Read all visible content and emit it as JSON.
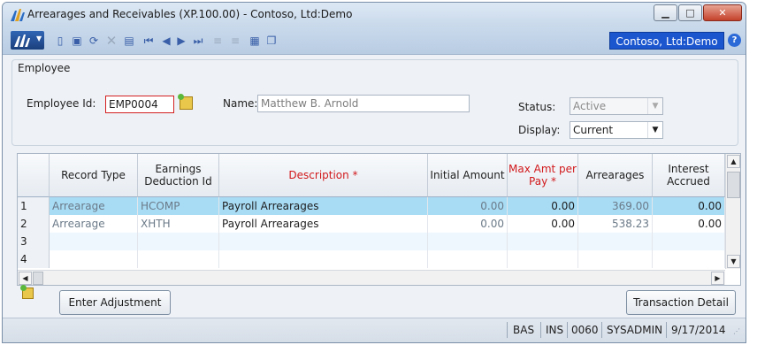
{
  "window": {
    "title": "Arrearages and Receivables (XP.100.00) - Contoso, Ltd:Demo",
    "minimize": "▁",
    "maximize": "□",
    "close": "✕"
  },
  "toolbar": {
    "company": "Contoso, Ltd:Demo",
    "help": "?",
    "icons": [
      "new-icon",
      "save-icon",
      "refresh-icon",
      "delete-icon",
      "close-record-icon",
      "first-icon",
      "previous-icon",
      "next-icon",
      "last-icon",
      "note-icon",
      "note-alt-icon",
      "report-icon",
      "copy-icon"
    ]
  },
  "employee": {
    "group_title": "Employee",
    "id_label": "Employee Id:",
    "id_value": "EMP0004",
    "name_label": "Name:",
    "name_value": "Matthew B. Arnold",
    "status_label": "Status:",
    "status_value": "Active",
    "display_label": "Display:",
    "display_value": "Current"
  },
  "grid": {
    "headers": [
      {
        "label": "Record Type",
        "required": false
      },
      {
        "label": "Earnings Deduction Id",
        "required": false
      },
      {
        "label": "Description *",
        "required": true
      },
      {
        "label": "Initial Amount",
        "required": false
      },
      {
        "label": "Max Amt per Pay *",
        "required": true
      },
      {
        "label": "Arrearages",
        "required": false
      },
      {
        "label": "Interest Accrued",
        "required": false
      }
    ],
    "rows": [
      {
        "num": "1",
        "record_type": "Arrearage",
        "earn_ded_id": "HCOMP",
        "description": "Payroll Arrearages",
        "initial_amount": "0.00",
        "max_amt": "0.00",
        "arrearages": "369.00",
        "interest": "0.00"
      },
      {
        "num": "2",
        "record_type": "Arrearage",
        "earn_ded_id": "XHTH",
        "description": "Payroll Arrearages",
        "initial_amount": "0.00",
        "max_amt": "0.00",
        "arrearages": "538.23",
        "interest": "0.00"
      },
      {
        "num": "3",
        "record_type": "",
        "earn_ded_id": "",
        "description": "",
        "initial_amount": "",
        "max_amt": "",
        "arrearages": "",
        "interest": ""
      },
      {
        "num": "4",
        "record_type": "",
        "earn_ded_id": "",
        "description": "",
        "initial_amount": "",
        "max_amt": "",
        "arrearages": "",
        "interest": ""
      }
    ]
  },
  "buttons": {
    "enter_adjustment": "Enter Adjustment",
    "transaction_detail": "Transaction Detail"
  },
  "status_bar": {
    "mode1": "BAS",
    "mode2": "INS",
    "code": "0060",
    "user": "SYSADMIN",
    "date": "9/17/2014"
  },
  "colors": {
    "selected_row": "#a8dcf5",
    "required_header": "#d1191c",
    "company_badge": "#1c56cf"
  }
}
